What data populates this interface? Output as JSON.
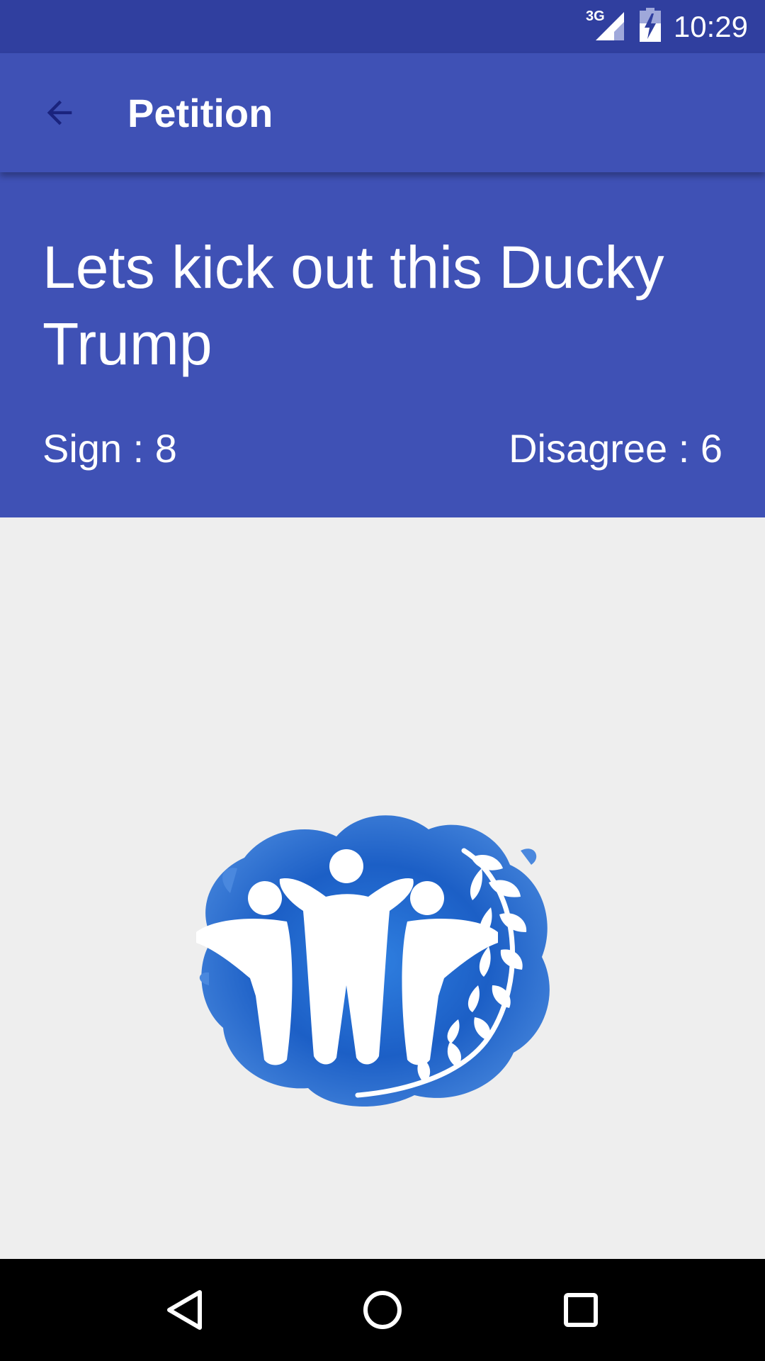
{
  "status_bar": {
    "network": "3G",
    "time": "10:29",
    "icons": [
      "signal-icon",
      "battery-charging-icon"
    ]
  },
  "toolbar": {
    "back_icon": "arrow-back-icon",
    "title": "Petition"
  },
  "petition": {
    "title": "Lets kick out this Ducky Trump",
    "sign_label": "Sign : 8",
    "disagree_label": "Disagree : 6"
  },
  "logo": {
    "icon": "people-laurel-logo"
  },
  "nav_bar": {
    "icons": [
      "back-triangle-icon",
      "home-circle-icon",
      "recents-square-icon"
    ]
  },
  "colors": {
    "status_bar": "#303f9f",
    "primary": "#3f51b5",
    "background": "#eeeeee",
    "nav_bar": "#000000",
    "logo_blue": "#1e63c9"
  }
}
